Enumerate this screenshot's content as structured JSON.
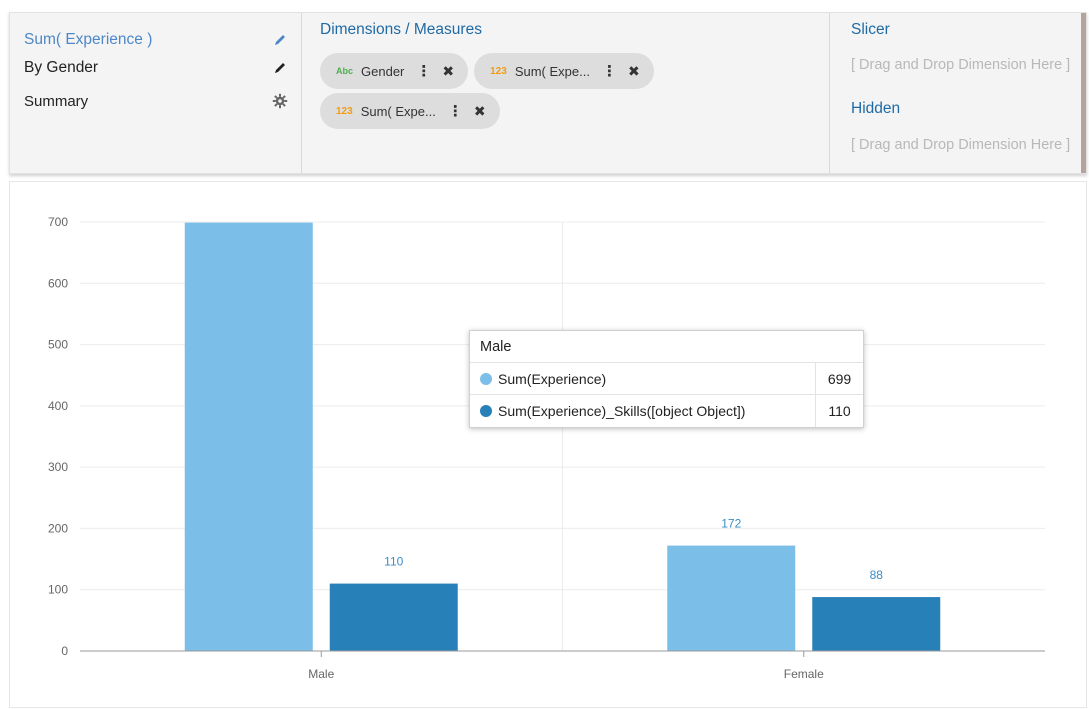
{
  "header": {
    "titles": [
      {
        "label": "Sum( Experience )",
        "icon": "pencil-icon"
      },
      {
        "label": "By Gender",
        "icon": "pencil-icon"
      },
      {
        "label": "Summary",
        "icon": "gear-icon"
      }
    ],
    "dimensions_measures": {
      "title": "Dimensions / Measures",
      "pills": [
        {
          "type": "Abc",
          "label": "Gender"
        },
        {
          "type": "123",
          "label": "Sum( Expe..."
        },
        {
          "type": "123",
          "label": "Sum( Expe..."
        }
      ]
    },
    "slicer": {
      "title": "Slicer",
      "placeholder": "[ Drag and Drop Dimension Here ]"
    },
    "hidden": {
      "title": "Hidden",
      "placeholder": "[ Drag and Drop Dimension Here ]"
    }
  },
  "chart_data": {
    "type": "bar",
    "categories": [
      "Male",
      "Female"
    ],
    "series": [
      {
        "name": "Sum(Experience)",
        "values": [
          699,
          172
        ],
        "color": "#7bbfe8"
      },
      {
        "name": "Sum(Experience)_Skills([object Object])",
        "values": [
          110,
          88
        ],
        "color": "#2880b9"
      }
    ],
    "data_labels": [
      [
        "",
        "110"
      ],
      [
        "172",
        "88"
      ]
    ],
    "yticks": [
      0,
      100,
      200,
      300,
      400,
      500,
      600,
      700
    ],
    "ylim": [
      0,
      700
    ],
    "grid": true
  },
  "tooltip": {
    "title": "Male",
    "rows": [
      {
        "name": "Sum(Experience)",
        "value": "699",
        "color": "#7bbfe8"
      },
      {
        "name": "Sum(Experience)_Skills([object Object])",
        "value": "110",
        "color": "#2880b9"
      }
    ]
  }
}
